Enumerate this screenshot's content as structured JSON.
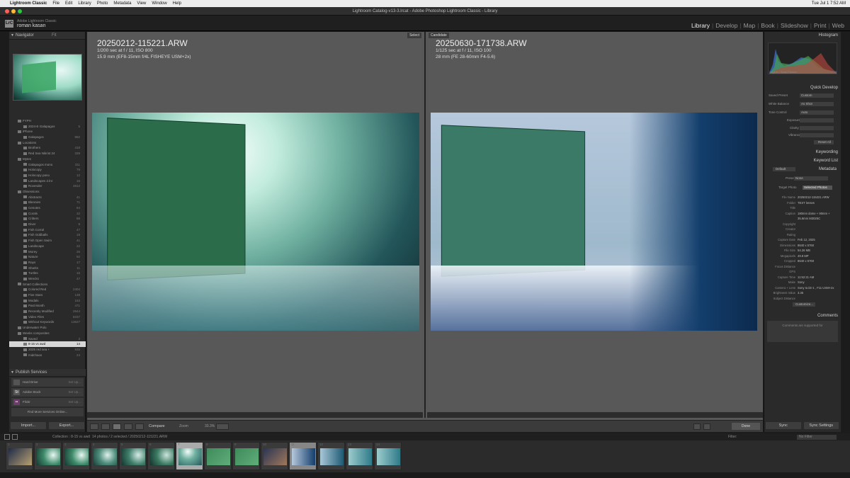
{
  "menubar": {
    "apple": "",
    "app": "Lightroom Classic",
    "items": [
      "File",
      "Edit",
      "Library",
      "Photo",
      "Metadata",
      "View",
      "Window",
      "Help"
    ],
    "clock": "Tue Jul 1  7:52 AM"
  },
  "window_title": "Lightroom Catalog-v13-3.lrcat - Adobe Photoshop Lightroom Classic - Library",
  "identity": {
    "app_name": "Adobe Lightroom Classic",
    "user": "roman kasan",
    "logo": "LrC"
  },
  "modules": [
    "Library",
    "Develop",
    "Map",
    "Book",
    "Slideshow",
    "Print",
    "Web"
  ],
  "active_module": "Library",
  "left": {
    "navigator": "Navigator",
    "nav_fit": "Fit",
    "collections": [
      {
        "label": "FYPH",
        "count": ""
      },
      {
        "label": "2024-E Galapagos",
        "count": "5"
      },
      {
        "label": "iPhone",
        "count": ""
      },
      {
        "label": "Galapagos",
        "count": "982"
      },
      {
        "label": "Locations",
        "count": ""
      },
      {
        "label": "Brothers",
        "count": "418"
      },
      {
        "label": "Red Sea Nikrist 24",
        "count": "339"
      },
      {
        "label": "Mytes",
        "count": ""
      },
      {
        "label": "Galapagos mono",
        "count": "311"
      },
      {
        "label": "Holocopy",
        "count": "79"
      },
      {
        "label": "Holocopy pano",
        "count": "12"
      },
      {
        "label": "Landscapes 2.lnr",
        "count": "16"
      },
      {
        "label": "Rovender",
        "count": "4812"
      },
      {
        "label": "Obsessions",
        "count": ""
      },
      {
        "label": "Abstracts",
        "count": "41"
      },
      {
        "label": "Blennies",
        "count": "71"
      },
      {
        "label": "Cenotes",
        "count": "94"
      },
      {
        "label": "Corals",
        "count": "32"
      },
      {
        "label": "Critters",
        "count": "88"
      },
      {
        "label": "Diver",
        "count": "9"
      },
      {
        "label": "Fish Corral",
        "count": "47"
      },
      {
        "label": "Fish Oddballs",
        "count": "19"
      },
      {
        "label": "Fish Open Swim",
        "count": "41"
      },
      {
        "label": "Landscape",
        "count": "22"
      },
      {
        "label": "Morey",
        "count": "26"
      },
      {
        "label": "Nature",
        "count": "92"
      },
      {
        "label": "Rays",
        "count": "17"
      },
      {
        "label": "Sharks",
        "count": "11"
      },
      {
        "label": "Turtles",
        "count": "16"
      },
      {
        "label": "Wrecks",
        "count": "47"
      },
      {
        "label": "Smart Collections",
        "count": ""
      },
      {
        "label": "Colored Red",
        "count": "2404"
      },
      {
        "label": "Five Stars",
        "count": "138"
      },
      {
        "label": "Modals",
        "count": "163"
      },
      {
        "label": "Past Month",
        "count": "471"
      },
      {
        "label": "Recently Modified",
        "count": "2644"
      },
      {
        "label": "Video Files",
        "count": "8337"
      },
      {
        "label": "Without Keywords",
        "count": "13627"
      },
      {
        "label": "Underwater Polo",
        "count": ""
      },
      {
        "label": "Weeks composites",
        "count": ""
      },
      {
        "label": "Saved",
        "count": "3"
      },
      {
        "label": "8-15 vs awd",
        "count": "14"
      },
      {
        "label": "2025 red sea +",
        "count": "936"
      },
      {
        "label": "midchaos",
        "count": "24"
      }
    ],
    "selected_collection_index": 41,
    "publish_title": "Publish Services",
    "publish": [
      {
        "icon": "",
        "label": "Hard Drive",
        "setup": "Set Up..."
      },
      {
        "icon": "St",
        "label": "Adobe Stock",
        "setup": "Set Up..."
      },
      {
        "icon": "••",
        "label": "Flickr",
        "setup": "Set Up..."
      }
    ],
    "find_more": "Find More Services Online...",
    "import_btn": "Import...",
    "export_btn": "Export..."
  },
  "compare": {
    "select_tag": "Select",
    "candidate_tag": "Candidate",
    "select": {
      "filename": "20250212-115221.ARW",
      "exposure": "1/200 sec at f / 11, ISO 800",
      "lens": "15.9 mm (EF8-15mm f/4L FISHEYE USM+2x)"
    },
    "candidate": {
      "filename": "20250630-171738.ARW",
      "exposure": "1/125 sec at f / 11, ISO 100",
      "lens": "28 mm (FE 28-60mm F4-5.6)"
    }
  },
  "toolbar": {
    "compare_label": "Compare",
    "zoom_label": "Zoom",
    "zoom_value": "33.3%",
    "done": "Done"
  },
  "right": {
    "histogram": "Histogram",
    "histo_info": "Original + Smart Preview",
    "quick_develop": "Quick Develop",
    "saved_preset": "Saved Preset",
    "saved_preset_val": "Custom",
    "white_balance": "White Balance",
    "white_balance_val": "As Shot",
    "tone_control": "Tone Control",
    "tone_val": "Auto",
    "exposure": "Exposure",
    "clarity": "Clarity",
    "vibrance": "Vibrance",
    "reset_all": "Reset All",
    "keywording": "Keywording",
    "keyword_list": "Keyword List",
    "metadata_preset": "Default",
    "metadata": "Metadata",
    "preset": "Preset",
    "preset_val": "None",
    "target_photo": "Target Photo",
    "selected_photos": "Selected Photos",
    "fields": [
      {
        "k": "File Name",
        "v": "20250212-115221.ARW"
      },
      {
        "k": "Folder",
        "v": "TEST lenses"
      },
      {
        "k": "Title",
        "v": ""
      },
      {
        "k": "Caption",
        "v": "180mm dome + 90mm +"
      },
      {
        "k": "",
        "v": "35.6mm M3025C"
      },
      {
        "k": "Copyright",
        "v": ""
      },
      {
        "k": "Creator",
        "v": ""
      },
      {
        "k": "Rating",
        "v": ""
      },
      {
        "k": "Capture Date",
        "v": "Feb 12, 2025"
      },
      {
        "k": "Dimensions",
        "v": "8640 x 5760"
      },
      {
        "k": "File Size",
        "v": "54.26 MB"
      },
      {
        "k": "Megapixels",
        "v": "49.8 MP"
      },
      {
        "k": "Cropped",
        "v": "8640 x 5760"
      },
      {
        "k": "Focus Distance",
        "v": ""
      },
      {
        "k": "GPS",
        "v": ""
      },
      {
        "k": "Capture Time",
        "v": "11:52:21 AM"
      },
      {
        "k": "Make",
        "v": "Sony"
      },
      {
        "k": "Camera + Lens",
        "v": "Sony ILCE-1 , F11 USM+2x"
      },
      {
        "k": "Brightness Value",
        "v": "3.35"
      },
      {
        "k": "Subject Distance",
        "v": ""
      }
    ],
    "customize": "Customize...",
    "comments": "Comments",
    "comments_placeholder": "Comments are supported for",
    "sync_btn": "Sync",
    "sync_settings_btn": "Sync Settings"
  },
  "filmstrip": {
    "collection_info": "Collection : 8-15 vs awd",
    "counts": "14 photos / 2 selected / 20250212-115221.ARW",
    "filter_label": "Filter:",
    "filter_value": "No Filter",
    "frames": [
      "1",
      "2",
      "3",
      "4",
      "5",
      "6",
      "7",
      "8",
      "9",
      "10",
      "11",
      "12",
      "13",
      "14"
    ]
  }
}
